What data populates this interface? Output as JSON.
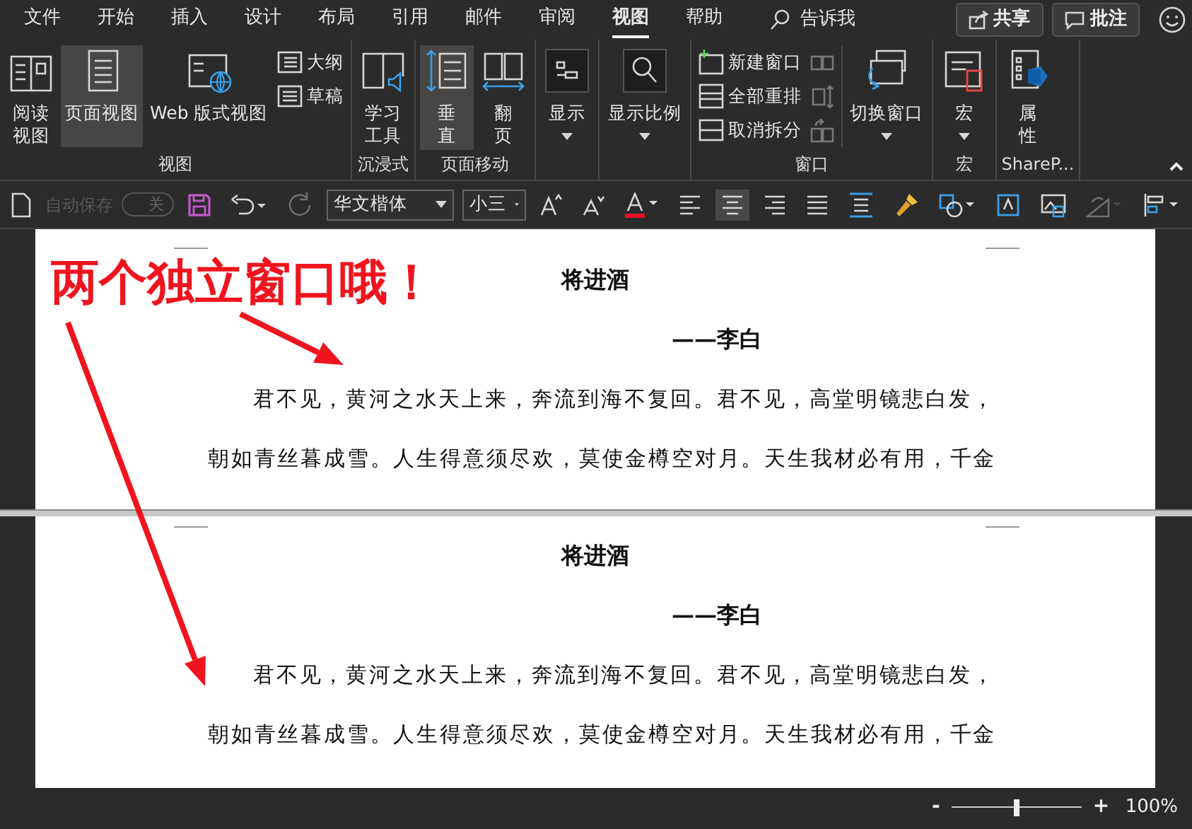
{
  "tabs": [
    {
      "label": "文件",
      "selected": false
    },
    {
      "label": "开始",
      "selected": false
    },
    {
      "label": "插入",
      "selected": false
    },
    {
      "label": "设计",
      "selected": false
    },
    {
      "label": "布局",
      "selected": false
    },
    {
      "label": "引用",
      "selected": false
    },
    {
      "label": "邮件",
      "selected": false
    },
    {
      "label": "审阅",
      "selected": false
    },
    {
      "label": "视图",
      "selected": true
    },
    {
      "label": "帮助",
      "selected": false
    }
  ],
  "tell_me": "告诉我",
  "share_button": "共享",
  "comments_button": "批注",
  "ribbon_groups": [
    {
      "label": "视图",
      "items": [
        {
          "kind": "large",
          "lines": [
            "阅读",
            "视图"
          ],
          "selected": false
        },
        {
          "kind": "large",
          "lines": [
            "页面视图"
          ],
          "selected": true
        },
        {
          "kind": "large",
          "lines": [
            "Web 版式视图"
          ],
          "selected": false
        },
        {
          "kind": "small-stack",
          "buttons": [
            {
              "label": "大纲"
            },
            {
              "label": "草稿"
            }
          ]
        }
      ]
    },
    {
      "label": "沉浸式",
      "items": [
        {
          "kind": "large",
          "lines": [
            "学习",
            "工具"
          ],
          "selected": false
        }
      ]
    },
    {
      "label": "页面移动",
      "items": [
        {
          "kind": "large",
          "lines": [
            "垂",
            "直"
          ],
          "selected": true
        },
        {
          "kind": "large",
          "lines": [
            "翻",
            "页"
          ],
          "selected": false
        }
      ]
    },
    {
      "items": [
        {
          "kind": "large",
          "lines": [
            "显示"
          ],
          "selected": false,
          "dropdown": true
        }
      ]
    },
    {
      "items": [
        {
          "kind": "large",
          "lines": [
            "显示比例"
          ],
          "selected": false,
          "dropdown": true
        }
      ]
    },
    {
      "label": "窗口",
      "items": [
        {
          "kind": "small-stack",
          "buttons": [
            {
              "label": "新建窗口"
            },
            {
              "label": "全部重排"
            },
            {
              "label": "取消拆分"
            }
          ]
        },
        {
          "kind": "icon-stack",
          "buttons": [
            {
              "disabled": true
            },
            {
              "disabled": true
            },
            {
              "disabled": true
            }
          ]
        },
        {
          "kind": "large",
          "lines": [
            "切换窗口"
          ],
          "selected": false,
          "dropdown": true
        }
      ]
    },
    {
      "label": "宏",
      "items": [
        {
          "kind": "large",
          "lines": [
            "宏"
          ],
          "selected": false,
          "dropdown": true
        }
      ]
    },
    {
      "label": "ShareP...",
      "items": [
        {
          "kind": "large",
          "lines": [
            "属",
            "性"
          ],
          "selected": false
        }
      ]
    }
  ],
  "toolbar": {
    "autosave": {
      "label": "自动保存",
      "toggle_label": "关",
      "on": false,
      "disabled": true
    },
    "redo_disabled": true,
    "font_name": "华文楷体",
    "font_size": "小三",
    "alignment": [
      {
        "selected": false
      },
      {
        "selected": true
      },
      {
        "selected": false
      },
      {
        "selected": false
      }
    ]
  },
  "panes": [
    {
      "title": "将进酒",
      "author": "——李白",
      "lines": [
        "君不见，黄河之水天上来，奔流到海不复回。君不见，高堂明镜悲白发，",
        "朝如青丝暮成雪。人生得意须尽欢，莫使金樽空对月。天生我材必有用，千金"
      ]
    },
    {
      "title": "将进酒",
      "author": "——李白",
      "lines": [
        "君不见，黄河之水天上来，奔流到海不复回。君不见，高堂明镜悲白发，",
        "朝如青丝暮成雪。人生得意须尽欢，莫使金樽空对月。天生我材必有用，千金"
      ]
    }
  ],
  "annotation": {
    "text": "两个独立窗口哦！"
  },
  "zoom": {
    "minus": "-",
    "plus": "+",
    "level": 0.5,
    "percent": "100%"
  }
}
